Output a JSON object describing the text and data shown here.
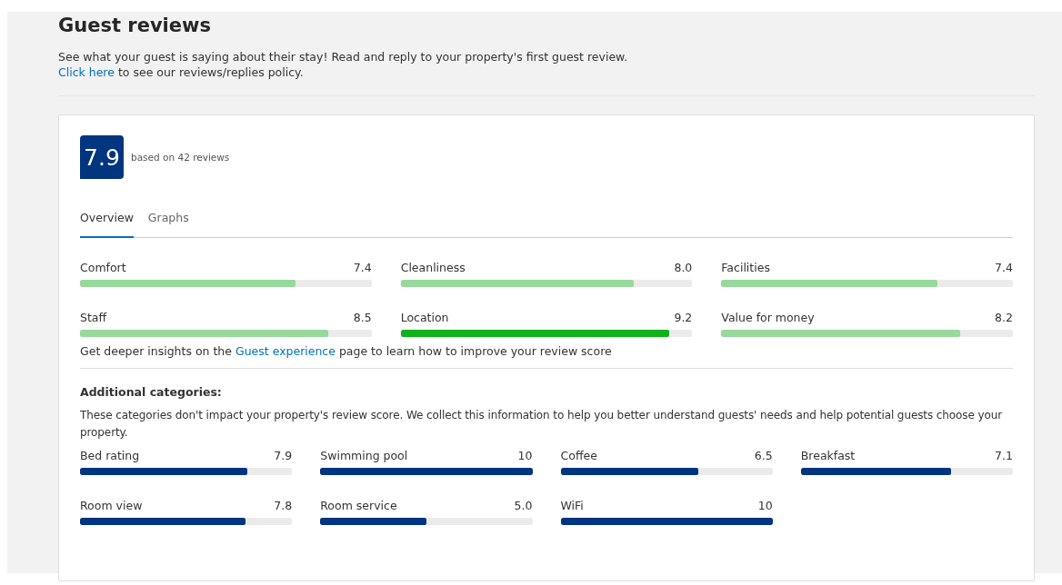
{
  "header": {
    "title": "Guest reviews",
    "intro": "See what your guest is saying about their stay! Read and reply to your property's first guest review.",
    "policy_link": "Click here",
    "policy_text": " to see our reviews/replies policy."
  },
  "score": {
    "value": "7.9",
    "caption": "based on 42 reviews"
  },
  "tabs": [
    {
      "label": "Overview",
      "selected": true
    },
    {
      "label": "Graphs",
      "selected": false
    }
  ],
  "categories": [
    {
      "name": "Comfort",
      "reading": "7.4",
      "level": 0.74,
      "color": "#97d89b"
    },
    {
      "name": "Cleanliness",
      "reading": "8.0",
      "level": 0.8,
      "color": "#97d89b"
    },
    {
      "name": "Facilities",
      "reading": "7.4",
      "level": 0.74,
      "color": "#97d89b"
    },
    {
      "name": "Staff",
      "reading": "8.5",
      "level": 0.85,
      "color": "#97d89b"
    },
    {
      "name": "Location",
      "reading": "9.2",
      "level": 0.92,
      "color": "#0fb21b"
    },
    {
      "name": "Value for money",
      "reading": "8.2",
      "level": 0.82,
      "color": "#97d89b"
    }
  ],
  "insights": {
    "before": "Get deeper insights on the ",
    "link": "Guest experience",
    "after": " page to learn how to improve your review score"
  },
  "additional": {
    "title": "Additional categories:",
    "note": "These categories don't impact your property's review score. We collect this information to help you better understand guests' needs and help potential guests choose your property.",
    "items": [
      {
        "name": "Bed rating",
        "reading": "7.9",
        "level": 0.79
      },
      {
        "name": "Swimming pool",
        "reading": "10",
        "level": 1.0
      },
      {
        "name": "Coffee",
        "reading": "6.5",
        "level": 0.65
      },
      {
        "name": "Breakfast",
        "reading": "7.1",
        "level": 0.71
      },
      {
        "name": "Room view",
        "reading": "7.8",
        "level": 0.78
      },
      {
        "name": "Room service",
        "reading": "5.0",
        "level": 0.5
      },
      {
        "name": "WiFi",
        "reading": "10",
        "level": 1.0
      }
    ]
  }
}
